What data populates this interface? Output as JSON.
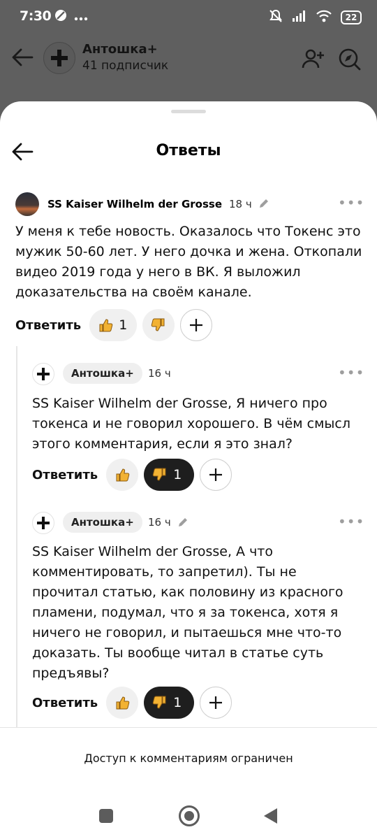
{
  "status_bar": {
    "time": "7:30",
    "battery": "22"
  },
  "channel": {
    "name": "Антошка+",
    "subscribers": "41 подписчик"
  },
  "sheet": {
    "title": "Ответы"
  },
  "comment": {
    "author": "SS Kaiser Wilhelm der Grosse",
    "time": "18 ч",
    "text": "У меня к тебе новость. Оказалось что Токенс это мужик 50-60 лет. У него дочка и жена. Откопали видео 2019 года у него в ВК. Я выложил доказательства на своём канале.",
    "reply_label": "Ответить",
    "likes": "1"
  },
  "replies": [
    {
      "author": "Антошка+",
      "time": "16 ч",
      "text": "SS Kaiser Wilhelm der Grosse, Я ничего про токенса и не говорил хорошего. В чём смысл этого комментария, если я это знал?",
      "reply_label": "Ответить",
      "dislikes": "1"
    },
    {
      "author": "Антошка+",
      "time": "16 ч",
      "text": "SS Kaiser Wilhelm der Grosse, А что комментировать, то запретил). Ты не прочитал статью, как половину из красного пламени, подумал, что я за токенса, хотя я ничего не говорил, и пытаешься мне что-то доказать. Ты вообще читал в статье суть предъявы?",
      "reply_label": "Ответить",
      "dislikes": "1"
    }
  ],
  "footer": {
    "restricted": "Доступ к комментариям ограничен"
  },
  "colors": {
    "dark_pill": "#1e1e1e",
    "light_pill": "#f0f0f0",
    "dimmed_bg": "#5f5f5f",
    "thumb": "#f2b233"
  }
}
